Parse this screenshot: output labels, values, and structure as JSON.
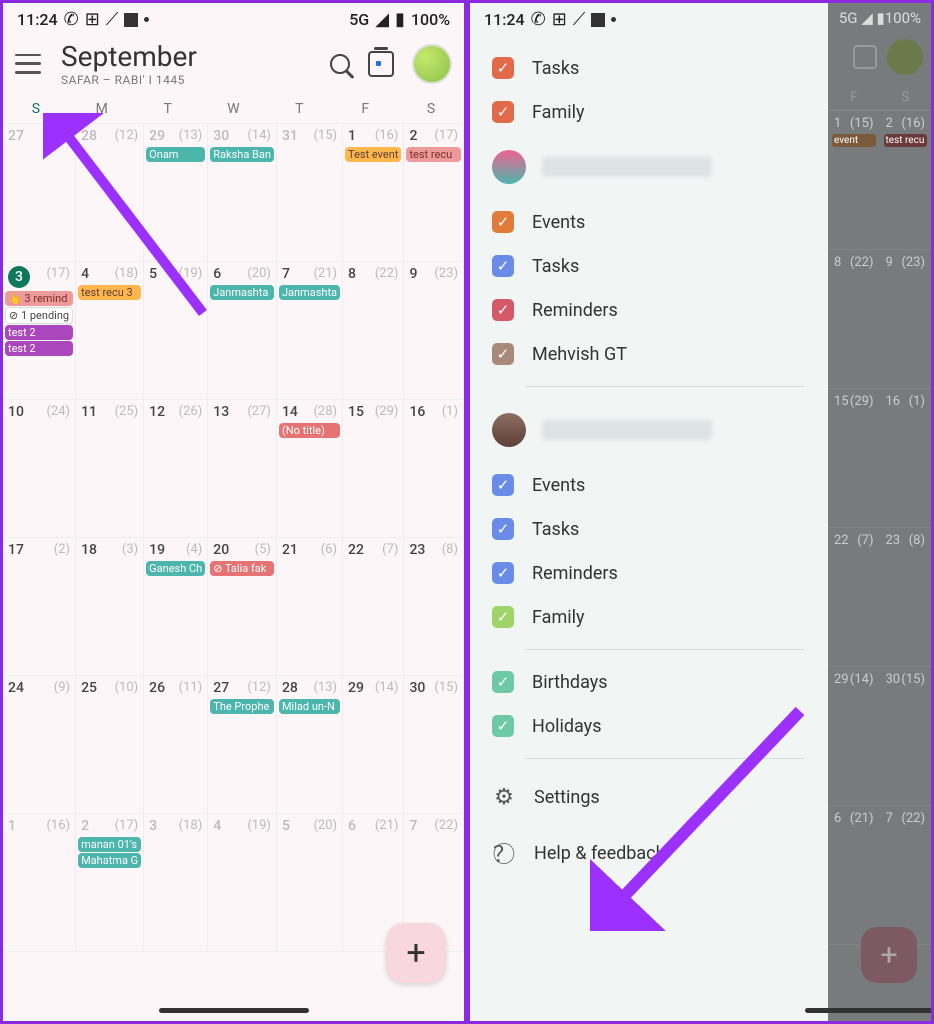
{
  "status": {
    "time": "11:24",
    "network": "5G",
    "battery": "100%"
  },
  "left": {
    "month": "September",
    "sub": "SAFAR – RABI' I 1445",
    "dow": [
      "S",
      "M",
      "T",
      "W",
      "T",
      "F",
      "S"
    ],
    "weeks": [
      [
        {
          "d": "27",
          "h": "(11)",
          "gray": true
        },
        {
          "d": "28",
          "h": "(12)",
          "gray": true
        },
        {
          "d": "29",
          "h": "(13)",
          "gray": true,
          "chips": [
            {
              "t": "Onam",
              "c": "teal"
            }
          ]
        },
        {
          "d": "30",
          "h": "(14)",
          "gray": true,
          "chips": [
            {
              "t": "Raksha Ban",
              "c": "teal"
            }
          ]
        },
        {
          "d": "31",
          "h": "(15)",
          "gray": true
        },
        {
          "d": "1",
          "h": "(16)",
          "chips": [
            {
              "t": "Test event",
              "c": "orange"
            }
          ]
        },
        {
          "d": "2",
          "h": "(17)",
          "chips": [
            {
              "t": "test recu",
              "c": "redlt"
            }
          ]
        }
      ],
      [
        {
          "d": "3",
          "h": "(17)",
          "today": true,
          "chips": [
            {
              "t": "👆 3 remind",
              "c": "redlt"
            },
            {
              "t": "⊘ 1 pending",
              "c": "white"
            },
            {
              "t": "test 2",
              "c": "purple"
            },
            {
              "t": "test 2",
              "c": "purple"
            }
          ]
        },
        {
          "d": "4",
          "h": "(18)",
          "chips": [
            {
              "t": "test recu 3",
              "c": "orange"
            }
          ]
        },
        {
          "d": "5",
          "h": "(19)"
        },
        {
          "d": "6",
          "h": "(20)",
          "chips": [
            {
              "t": "Janmashta",
              "c": "teal"
            }
          ]
        },
        {
          "d": "7",
          "h": "(21)",
          "chips": [
            {
              "t": "Janmashta",
              "c": "teal"
            }
          ]
        },
        {
          "d": "8",
          "h": "(22)"
        },
        {
          "d": "9",
          "h": "(23)"
        }
      ],
      [
        {
          "d": "10",
          "h": "(24)"
        },
        {
          "d": "11",
          "h": "(25)"
        },
        {
          "d": "12",
          "h": "(26)"
        },
        {
          "d": "13",
          "h": "(27)"
        },
        {
          "d": "14",
          "h": "(28)",
          "chips": [
            {
              "t": "(No title)",
              "c": "red"
            }
          ]
        },
        {
          "d": "15",
          "h": "(29)"
        },
        {
          "d": "16",
          "h": "(1)"
        }
      ],
      [
        {
          "d": "17",
          "h": "(2)"
        },
        {
          "d": "18",
          "h": "(3)"
        },
        {
          "d": "19",
          "h": "(4)",
          "chips": [
            {
              "t": "Ganesh Ch",
              "c": "teal"
            }
          ]
        },
        {
          "d": "20",
          "h": "(5)",
          "chips": [
            {
              "t": "⊘ Talia fak",
              "c": "red"
            }
          ]
        },
        {
          "d": "21",
          "h": "(6)"
        },
        {
          "d": "22",
          "h": "(7)"
        },
        {
          "d": "23",
          "h": "(8)"
        }
      ],
      [
        {
          "d": "24",
          "h": "(9)"
        },
        {
          "d": "25",
          "h": "(10)"
        },
        {
          "d": "26",
          "h": "(11)"
        },
        {
          "d": "27",
          "h": "(12)",
          "chips": [
            {
              "t": "The Prophe",
              "c": "teal"
            }
          ]
        },
        {
          "d": "28",
          "h": "(13)",
          "chips": [
            {
              "t": "Milad un-N",
              "c": "teal"
            }
          ]
        },
        {
          "d": "29",
          "h": "(14)"
        },
        {
          "d": "30",
          "h": "(15)"
        }
      ],
      [
        {
          "d": "1",
          "h": "(16)",
          "gray": true
        },
        {
          "d": "2",
          "h": "(17)",
          "gray": true,
          "chips": [
            {
              "t": "manan 01's",
              "c": "teal"
            },
            {
              "t": "Mahatma G",
              "c": "teal"
            }
          ]
        },
        {
          "d": "3",
          "h": "(18)",
          "gray": true
        },
        {
          "d": "4",
          "h": "(19)",
          "gray": true
        },
        {
          "d": "5",
          "h": "(20)",
          "gray": true
        },
        {
          "d": "6",
          "h": "(21)",
          "gray": true
        },
        {
          "d": "7",
          "h": "(22)",
          "gray": true
        }
      ]
    ]
  },
  "drawer": {
    "top": [
      {
        "label": "Tasks",
        "color": "#e06a4a"
      },
      {
        "label": "Family",
        "color": "#e06a4a"
      }
    ],
    "account1_items": [
      {
        "label": "Events",
        "color": "#e07b3a"
      },
      {
        "label": "Tasks",
        "color": "#6a8ce8"
      },
      {
        "label": "Reminders",
        "color": "#d45a6a"
      },
      {
        "label": "Mehvish GT",
        "color": "#a88a7a"
      }
    ],
    "account2_items": [
      {
        "label": "Events",
        "color": "#6a8ce8"
      },
      {
        "label": "Tasks",
        "color": "#6a8ce8"
      },
      {
        "label": "Reminders",
        "color": "#6a8ce8"
      },
      {
        "label": "Family",
        "color": "#a0d468"
      }
    ],
    "extras": [
      {
        "label": "Birthdays",
        "color": "#6dc9a8"
      },
      {
        "label": "Holidays",
        "color": "#6dc9a8"
      }
    ],
    "settings": "Settings",
    "help": "Help & feedback"
  },
  "dim": {
    "dow": [
      "F",
      "S"
    ],
    "rows": [
      [
        {
          "d": "1",
          "h": "(15)",
          "chips": [
            {
              "t": "event",
              "bg": "#7a5a3a"
            }
          ]
        },
        {
          "d": "2",
          "h": "(16)",
          "chips": [
            {
              "t": "test recu",
              "bg": "#6a3a3a"
            }
          ]
        }
      ],
      [
        {
          "d": "8",
          "h": "(22)"
        },
        {
          "d": "9",
          "h": "(23)"
        }
      ],
      [
        {
          "d": "15",
          "h": "(29)"
        },
        {
          "d": "16",
          "h": "(1)"
        }
      ],
      [
        {
          "d": "22",
          "h": "(7)"
        },
        {
          "d": "23",
          "h": "(8)"
        }
      ],
      [
        {
          "d": "29",
          "h": "(14)"
        },
        {
          "d": "30",
          "h": "(15)"
        }
      ],
      [
        {
          "d": "6",
          "h": "(21)"
        },
        {
          "d": "7",
          "h": "(22)"
        }
      ]
    ]
  }
}
